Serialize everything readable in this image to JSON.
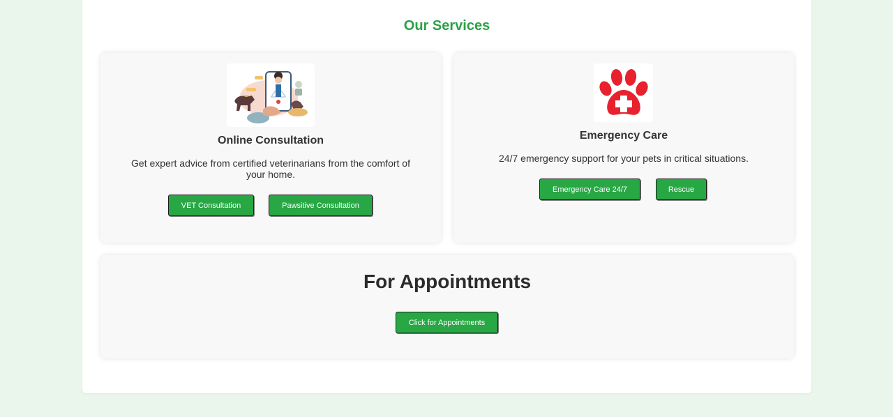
{
  "services": {
    "title": "Our Services",
    "cards": [
      {
        "title": "Online Consultation",
        "description": "Get expert advice from certified veterinarians from the comfort of your home.",
        "image_icon": "vet-consultation-illustration",
        "buttons": [
          "VET Consultation",
          "Pawsitive Consultation"
        ]
      },
      {
        "title": "Emergency Care",
        "description": "24/7 emergency support for your pets in critical situations.",
        "image_icon": "paw-medical-cross-icon",
        "buttons": [
          "Emergency Care 24/7",
          "Rescue"
        ]
      }
    ]
  },
  "appointments": {
    "title": "For Appointments",
    "button": "Click for Appointments"
  },
  "colors": {
    "accent": "#28a745",
    "heading_green": "#2aa146",
    "page_bg": "#eaf6ec",
    "paw_red": "#e8212e"
  }
}
